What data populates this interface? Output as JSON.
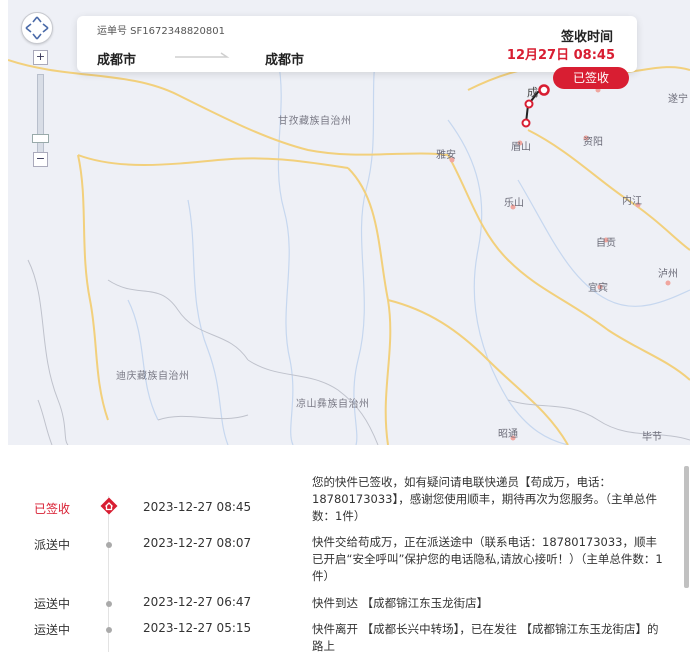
{
  "chart_data": {
    "type": "map",
    "origin_city": "成都市",
    "destination_city": "成都市",
    "colors": {
      "route": "#222222",
      "route_active": "#d81e32",
      "card_time": "#d81e32",
      "badge": "#d81e32"
    },
    "place_labels": [
      {
        "id": "ganzi",
        "text": "甘孜藏族自治州"
      },
      {
        "id": "yaan",
        "text": "雅安"
      },
      {
        "id": "meishan",
        "text": "眉山"
      },
      {
        "id": "ziyang",
        "text": "资阳"
      },
      {
        "id": "suining",
        "text": "遂宁"
      },
      {
        "id": "leshan",
        "text": "乐山"
      },
      {
        "id": "neijiang",
        "text": "内江"
      },
      {
        "id": "zigong",
        "text": "自贡"
      },
      {
        "id": "yibin",
        "text": "宜宾"
      },
      {
        "id": "luzhou",
        "text": "泸州"
      },
      {
        "id": "diqing",
        "text": "迪庆藏族自治州"
      },
      {
        "id": "liangshan",
        "text": "凉山彝族自治州"
      },
      {
        "id": "zhaotong",
        "text": "昭通"
      },
      {
        "id": "bijie",
        "text": "毕节"
      },
      {
        "id": "cheng_partial",
        "text": "成"
      }
    ]
  },
  "card": {
    "waybill": "运单号 SF1672348820801",
    "from": "成都市",
    "to": "成都市",
    "signed_label": "签收时间",
    "signed_time": "12月27日 08:45"
  },
  "map_badge": "已签收",
  "zoom_controls": {
    "plus": "+",
    "minus": "−"
  },
  "timeline": [
    {
      "status": "已签收",
      "time": "2023-12-27 08:45",
      "desc": "您的快件已签收，如有疑问请电联快递员【苟成万，电话：18780173033】，感谢您使用顺丰，期待再次为您服务。（主单总件数：1件）",
      "active": true
    },
    {
      "status": "派送中",
      "time": "2023-12-27 08:07",
      "desc": "快件交给苟成万，正在派送途中（联系电话：18780173033，顺丰已开启“安全呼叫”保护您的电话隐私,请放心接听！）（主单总件数：1件）",
      "active": false
    },
    {
      "status": "运送中",
      "time": "2023-12-27 06:47",
      "desc": "快件到达 【成都锦江东玉龙街店】",
      "active": false
    },
    {
      "status": "运送中",
      "time": "2023-12-27 05:15",
      "desc": "快件离开 【成都长兴中转场】，已在发往 【成都锦江东玉龙街店】的路上",
      "active": false
    }
  ]
}
